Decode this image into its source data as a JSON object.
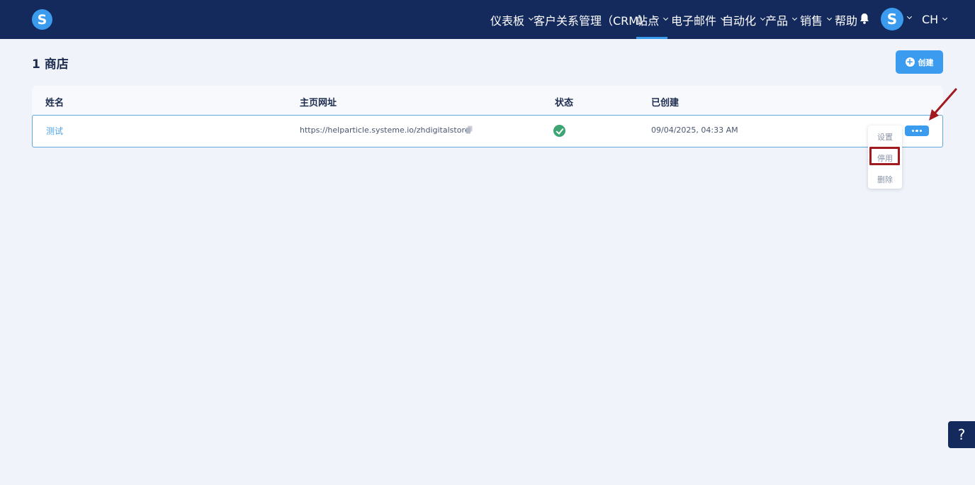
{
  "nav": {
    "logo": "S",
    "items": [
      {
        "label": "仪表板"
      },
      {
        "label": "客户关系管理（CRM）"
      },
      {
        "label": "站点"
      },
      {
        "label": "电子邮件"
      },
      {
        "label": "自动化"
      },
      {
        "label": "产品"
      },
      {
        "label": "销售"
      },
      {
        "label": "帮助"
      }
    ],
    "active_item": "站点",
    "avatar": "S",
    "language": "CH"
  },
  "page": {
    "title": "1 商店",
    "create_label": "创建"
  },
  "table": {
    "columns": [
      "姓名",
      "主页网址",
      "状态",
      "已创建"
    ],
    "rows": [
      {
        "name": "测试",
        "url": "https://helparticle.systeme.io/zhdigitalstore",
        "status": "active",
        "created": "09/04/2025, 04:33 AM"
      }
    ]
  },
  "dropdown": {
    "items": [
      "设置",
      "停用",
      "删除"
    ],
    "highlighted": "停用"
  },
  "help": "?",
  "colors": {
    "nav_bg": "#142a5c",
    "accent": "#3b9bef",
    "status_green": "#3da573",
    "highlight_red": "#a11a1f"
  }
}
